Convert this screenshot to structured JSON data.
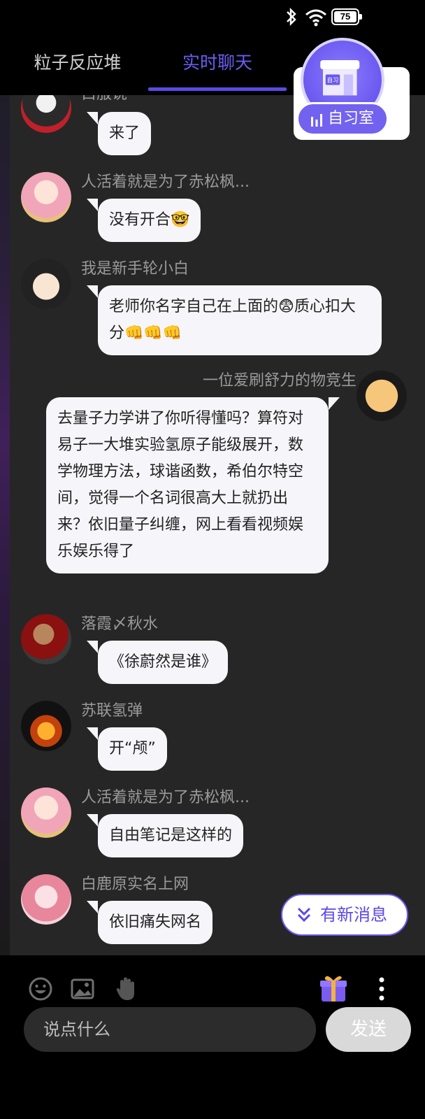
{
  "status_bar": {
    "battery": "75"
  },
  "tabs": [
    {
      "label": "粒子反应堆",
      "active": false
    },
    {
      "label": "实时聊天",
      "active": true
    }
  ],
  "study_room": {
    "label": "自习室",
    "badge_text": "自习"
  },
  "messages": [
    {
      "sender": "白服说",
      "text": "来了",
      "side": "left",
      "avatar": "avatar-dark-hair"
    },
    {
      "sender": "人活着就是为了赤松枫...",
      "text": "没有开合🤓",
      "side": "left",
      "avatar": "avatar-pink-girl"
    },
    {
      "sender": "我是新手轮小白",
      "text": "老师你名字自己在上面的😨质心扣大分👊👊👊",
      "side": "left",
      "avatar": "avatar-anime-boy"
    },
    {
      "sender": "一位爱刷舒力的物竞生",
      "text": "去量子力学讲了你听得懂吗？算符对易子一大堆实验氢原子能级展开，数学物理方法，球谐函数，希伯尔特空间，觉得一个名词很高大上就扔出来？依旧量子纠缠，网上看看视频娱乐娱乐得了",
      "side": "right",
      "avatar": "avatar-bear"
    },
    {
      "sender": "落霞〆秋水",
      "text": "《徐蔚然是谁》",
      "side": "left",
      "avatar": "avatar-football"
    },
    {
      "sender": "苏联氢弹",
      "text": "开“颅”",
      "side": "left",
      "avatar": "avatar-explosion"
    },
    {
      "sender": "人活着就是为了赤松枫...",
      "text": "自由笔记是这样的",
      "side": "left",
      "avatar": "avatar-pink-girl"
    },
    {
      "sender": "白鹿原实名上网",
      "text": "依旧痛失网名",
      "side": "left",
      "avatar": "avatar-pink-hair"
    }
  ],
  "new_message_button": {
    "label": "有新消息"
  },
  "toolbar": {
    "icons": [
      "emoji-icon",
      "image-icon",
      "raise-hand-icon",
      "gift-icon",
      "more-icon"
    ],
    "input_placeholder": "说点什么",
    "send_label": "发送"
  },
  "colors": {
    "accent": "#5b49e8",
    "chat_bg": "#262626",
    "bubble": "#f6f6fa"
  }
}
